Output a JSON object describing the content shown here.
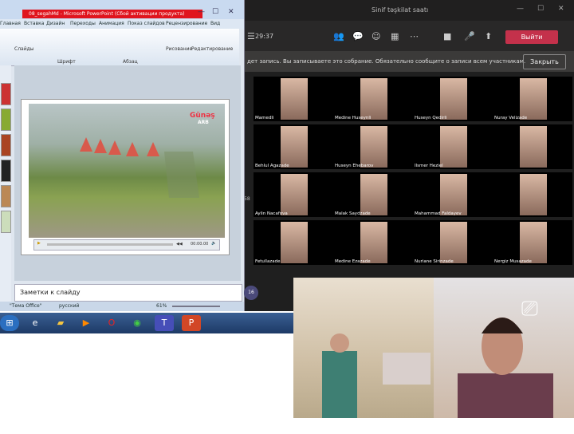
{
  "teams": {
    "window_title": "Sinif təşkilat saatı",
    "timer": "29:37",
    "leave_label": "Выйти",
    "recording_message": "дет запись. Вы записываете это собрание. Обязательно сообщите о записи всем участникам.",
    "close_label": "Закрыть",
    "participants": [
      {
        "name": "Mamedli"
      },
      {
        "name": "Medine Huseynli"
      },
      {
        "name": "Huseyn Qedirli"
      },
      {
        "name": "Nuray Velizade"
      },
      {
        "name": "Behlul Agazade"
      },
      {
        "name": "Huseyn Ehebarov"
      },
      {
        "name": "Ilsmer Heziel"
      },
      {
        "name": ""
      },
      {
        "name": "Aylin Nacafova"
      },
      {
        "name": "Malak Saydzade"
      },
      {
        "name": "Mahammad Faldayev"
      },
      {
        "name": ""
      },
      {
        "name": "Fetullazade"
      },
      {
        "name": "Medine Ezazade"
      },
      {
        "name": "Nuriane Sirinzade"
      },
      {
        "name": "Nergiz Musazade"
      }
    ],
    "extra_count": "16",
    "side_label": "58"
  },
  "ppt": {
    "title": "08_segahMd - Microsoft PowerPoint (Сбой активации продукта)",
    "tabs": [
      "Главная",
      "Вставка",
      "Дизайн",
      "Переходы",
      "Анимация",
      "Показ слайдов",
      "Рецензирование",
      "Вид"
    ],
    "ribbon": {
      "slides": "Слайды",
      "font": "Шрифт",
      "para": "Абзац",
      "drawing": "Рисование",
      "editing": "Редактирование"
    },
    "logo_text": "Günəş",
    "logo_sub": "ARB",
    "video_time": "00:00.00",
    "notes_placeholder": "Заметки к слайду",
    "status": {
      "theme": "\"Тема Office\"",
      "lang": "русский",
      "zoom": "61%"
    }
  },
  "colors": {
    "teams_bg": "#1f1f1f",
    "leave": "#c4314b",
    "ppt_red_title": "#e0141e"
  },
  "icons": [
    "windows-start-icon",
    "ie-icon",
    "folder-icon",
    "media-icon",
    "opera-icon",
    "chrome-icon",
    "teams-icon",
    "powerpoint-icon",
    "camera-switch-icon"
  ]
}
